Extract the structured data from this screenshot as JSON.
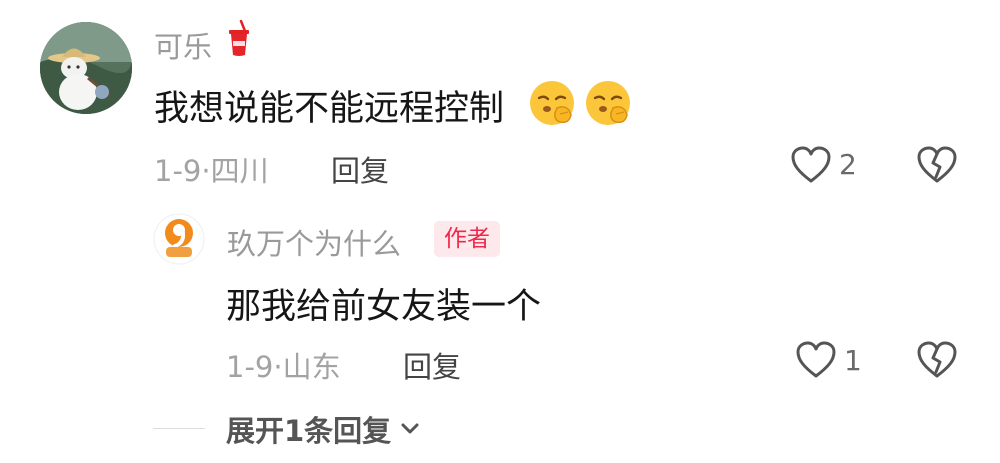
{
  "comments": [
    {
      "username": "可乐",
      "username_icon": "soda-cup-icon",
      "text": "我想说能不能远程控制",
      "text_emojis": [
        "shushing-face-icon",
        "shushing-face-icon"
      ],
      "date": "1-9·",
      "location": "四川",
      "reply_label": "回复",
      "likes": "2"
    },
    {
      "username": "玖万个为什么",
      "badge": "作者",
      "text": "那我给前女友装一个",
      "date": "1-9·",
      "location": "山东",
      "reply_label": "回复",
      "likes": "1"
    }
  ],
  "expand_replies": {
    "label": "展开1条回复",
    "icon": "chevron-down-icon"
  },
  "colors": {
    "badge_text": "#ee2a4c",
    "badge_bg": "#fde8ec",
    "meta_text": "#a3a3a3"
  }
}
